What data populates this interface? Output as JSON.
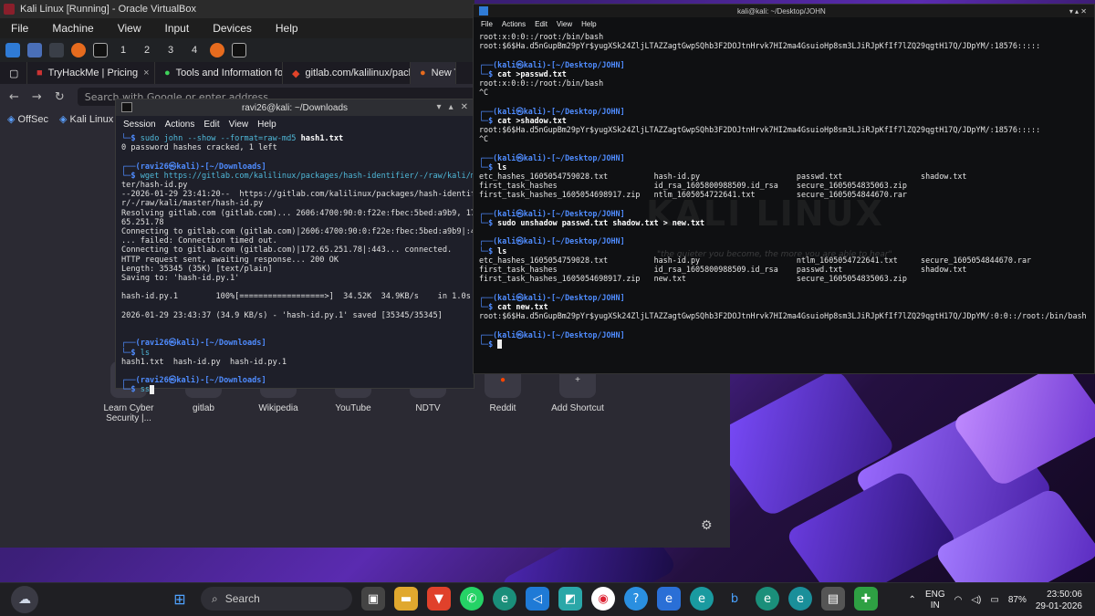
{
  "vbox": {
    "title": "Kali Linux [Running] - Oracle VirtualBox",
    "menu": [
      "File",
      "Machine",
      "View",
      "Input",
      "Devices",
      "Help"
    ]
  },
  "kali_panel": {
    "workspaces": [
      "1",
      "2",
      "3",
      "4"
    ]
  },
  "browser": {
    "tabs": [
      {
        "label": "TryHackMe | Pricing"
      },
      {
        "label": "Tools and Information for"
      },
      {
        "label": "gitlab.com/kalilinux/pack"
      },
      {
        "label": "New T"
      }
    ],
    "url_placeholder": "Search with Google or enter address",
    "bookmarks": [
      "OffSec",
      "Kali Linux"
    ],
    "shortcuts": [
      {
        "label": "Learn Cyber Security |..."
      },
      {
        "label": "gitlab"
      },
      {
        "label": "Wikipedia"
      },
      {
        "label": "YouTube"
      },
      {
        "label": "NDTV"
      },
      {
        "label": "Reddit"
      },
      {
        "label": "Add Shortcut"
      }
    ]
  },
  "left_terminal": {
    "title": "ravi26@kali: ~/Downloads",
    "menu": [
      "Session",
      "Actions",
      "Edit",
      "View",
      "Help"
    ],
    "lines": [
      {
        "t": "└─$ ",
        "c": "sudo john --show --format=raw-md5 ",
        "b": "hash1.txt"
      },
      {
        "t": "0 password hashes cracked, 1 left"
      },
      {
        "t": ""
      },
      {
        "prompt": "┌──(ravi26㉿kali)-[~/Downloads]"
      },
      {
        "t": "└─$ ",
        "c": "wget https://gitlab.com/kalilinux/packages/hash-identifier/-/raw/kali/mas"
      },
      {
        "t": "ter/hash-id.py"
      },
      {
        "t": "--2026-01-29 23:41:20--  https://gitlab.com/kalilinux/packages/hash-identifie"
      },
      {
        "t": "r/-/raw/kali/master/hash-id.py"
      },
      {
        "t": "Resolving gitlab.com (gitlab.com)... 2606:4700:90:0:f22e:fbec:5bed:a9b9, 172."
      },
      {
        "t": "65.251.78"
      },
      {
        "t": "Connecting to gitlab.com (gitlab.com)|2606:4700:90:0:f22e:fbec:5bed:a9b9|:443"
      },
      {
        "t": "... failed: Connection timed out."
      },
      {
        "t": "Connecting to gitlab.com (gitlab.com)|172.65.251.78|:443... connected."
      },
      {
        "t": "HTTP request sent, awaiting response... 200 OK"
      },
      {
        "t": "Length: 35345 (35K) [text/plain]"
      },
      {
        "t": "Saving to: 'hash-id.py.1'"
      },
      {
        "t": ""
      },
      {
        "t": "hash-id.py.1        100%[==================>]  34.52K  34.9KB/s    in 1.0s"
      },
      {
        "t": ""
      },
      {
        "t": "2026-01-29 23:43:37 (34.9 KB/s) - 'hash-id.py.1' saved [35345/35345]"
      },
      {
        "t": ""
      },
      {
        "t": ""
      },
      {
        "prompt": "┌──(ravi26㉿kali)-[~/Downloads]"
      },
      {
        "t": "└─$ ",
        "c": "ls"
      },
      {
        "t": "hash1.txt  hash-id.py  hash-id.py.1"
      },
      {
        "t": ""
      },
      {
        "prompt": "┌──(ravi26㉿kali)-[~/Downloads]"
      },
      {
        "t": "└─$ ",
        "c": "ss",
        "cursor": true
      }
    ]
  },
  "vm_terminal": {
    "title": "kali@kali: ~/Desktop/JOHN",
    "menu": [
      "File",
      "Actions",
      "Edit",
      "View",
      "Help"
    ],
    "watermark": "KALI LINUX",
    "tagline": "\"the quieter you become, the more you are able to hear\"",
    "lines": [
      {
        "t": "root:x:0:0::/root:/bin/bash"
      },
      {
        "t": "root:$6$Ha.d5nGupBm29pYr$yugXSk24ZljLTAZZagtGwpSQhb3F2DOJtnHrvk7HI2ma4GsuioHp8sm3LJiRJpKfIf7lZQ29qgtH17Q/JDpYM/:18576:::::"
      },
      {
        "t": ""
      },
      {
        "prompt": "┌──(kali㉿kali)-[~/Desktop/JOHN]"
      },
      {
        "t": "└─$ ",
        "c": "cat >passwd.txt"
      },
      {
        "t": "root:x:0:0::/root:/bin/bash"
      },
      {
        "t": "^C"
      },
      {
        "t": ""
      },
      {
        "prompt": "┌──(kali㉿kali)-[~/Desktop/JOHN]"
      },
      {
        "t": "└─$ ",
        "c": "cat >shadow.txt"
      },
      {
        "t": "root:$6$Ha.d5nGupBm29pYr$yugXSk24ZljLTAZZagtGwpSQhb3F2DOJtnHrvk7HI2ma4GsuioHp8sm3LJiRJpKfIf7lZQ29qgtH17Q/JDpYM/:18576:::::"
      },
      {
        "t": "^C"
      },
      {
        "t": ""
      },
      {
        "prompt": "┌──(kali㉿kali)-[~/Desktop/JOHN]"
      },
      {
        "t": "└─$ ",
        "c": "ls"
      },
      {
        "t": "etc_hashes_1605054759028.txt          hash-id.py                     passwd.txt                 shadow.txt"
      },
      {
        "t": "first_task_hashes                     id_rsa_1605800988509.id_rsa    secure_1605054835063.zip"
      },
      {
        "t": "first_task_hashes_1605054698917.zip   ntlm_1605054722641.txt         secure_1605054844670.rar"
      },
      {
        "t": ""
      },
      {
        "prompt": "┌──(kali㉿kali)-[~/Desktop/JOHN]"
      },
      {
        "t": "└─$ ",
        "c": "sudo unshadow passwd.txt shadow.txt > new.txt"
      },
      {
        "t": ""
      },
      {
        "prompt": "┌──(kali㉿kali)-[~/Desktop/JOHN]"
      },
      {
        "t": "└─$ ",
        "c": "ls"
      },
      {
        "t": "etc_hashes_1605054759028.txt          hash-id.py                     ntlm_1605054722641.txt     secure_1605054844670.rar"
      },
      {
        "t": "first_task_hashes                     id_rsa_1605800988509.id_rsa    passwd.txt                 shadow.txt"
      },
      {
        "t": "first_task_hashes_1605054698917.zip   new.txt                        secure_1605054835063.zip"
      },
      {
        "t": ""
      },
      {
        "prompt": "┌──(kali㉿kali)-[~/Desktop/JOHN]"
      },
      {
        "t": "└─$ ",
        "c": "cat new.txt"
      },
      {
        "t": "root:$6$Ha.d5nGupBm29pYr$yugXSk24ZljLTAZZagtGwpSQhb3F2DOJtnHrvk7HI2ma4GsuioHp8sm3LJiRJpKfIf7lZQ29qgtH17Q/JDpYM/:0:0::/root:/bin/bash"
      },
      {
        "t": ""
      },
      {
        "prompt": "┌──(kali㉿kali)-[~/Desktop/JOHN]"
      },
      {
        "t": "└─$ ",
        "c": "",
        "cursor": true
      }
    ]
  },
  "taskbar": {
    "search_label": "Search",
    "lang": "ENG",
    "region": "IN",
    "battery": "87%",
    "time": "23:50:06",
    "date": "29-01-2026"
  }
}
